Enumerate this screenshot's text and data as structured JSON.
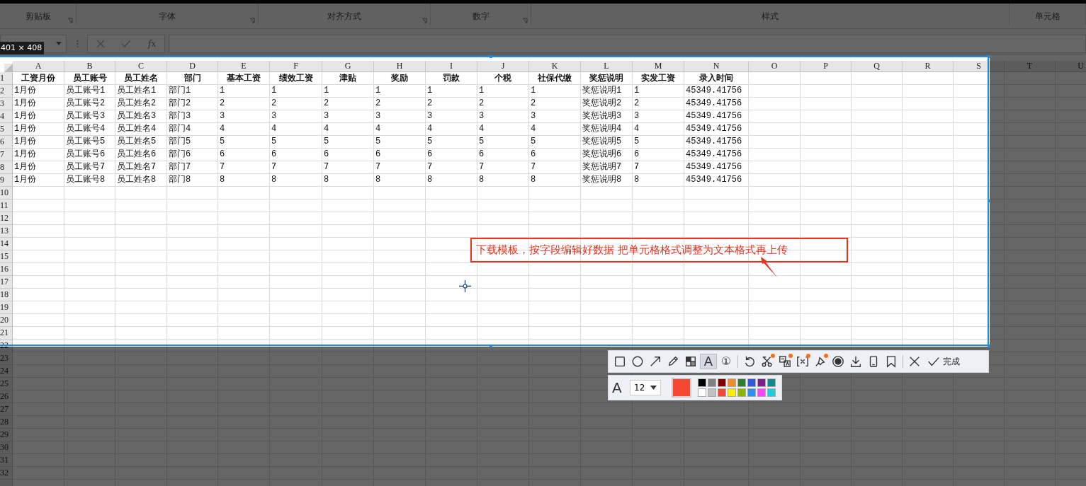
{
  "ribbon": {
    "groups": [
      {
        "label": "剪贴板",
        "launcher": true
      },
      {
        "label": "字体",
        "launcher": true
      },
      {
        "label": "对齐方式",
        "launcher": true
      },
      {
        "label": "数字",
        "launcher": true
      },
      {
        "label": "样式",
        "launcher": false
      },
      {
        "label": "单元格",
        "launcher": false
      }
    ]
  },
  "formula_bar": {
    "function_button": "fx"
  },
  "sheet": {
    "columns": [
      "A",
      "B",
      "C",
      "D",
      "E",
      "F",
      "G",
      "H",
      "I",
      "J",
      "K",
      "L",
      "M",
      "N",
      "O",
      "P",
      "Q",
      "R",
      "S",
      "T",
      "U"
    ],
    "rows": [
      {
        "number": "1",
        "kind": "header",
        "cells": [
          "工资月份",
          "员工账号",
          "员工姓名",
          "部门",
          "基本工资",
          "绩效工资",
          "津贴",
          "奖励",
          "罚款",
          "个税",
          "社保代缴",
          "奖惩说明",
          "实发工资",
          "录入时间"
        ]
      },
      {
        "number": "2",
        "kind": "data",
        "cells": [
          "1月份",
          "员工账号1",
          "员工姓名1",
          "部门1",
          "1",
          "1",
          "1",
          "1",
          "1",
          "1",
          "1",
          "奖惩说明1",
          "1",
          "45349.41756"
        ]
      },
      {
        "number": "3",
        "kind": "data",
        "cells": [
          "1月份",
          "员工账号2",
          "员工姓名2",
          "部门2",
          "2",
          "2",
          "2",
          "2",
          "2",
          "2",
          "2",
          "奖惩说明2",
          "2",
          "45349.41756"
        ]
      },
      {
        "number": "4",
        "kind": "data",
        "cells": [
          "1月份",
          "员工账号3",
          "员工姓名3",
          "部门3",
          "3",
          "3",
          "3",
          "3",
          "3",
          "3",
          "3",
          "奖惩说明3",
          "3",
          "45349.41756"
        ]
      },
      {
        "number": "5",
        "kind": "data",
        "cells": [
          "1月份",
          "员工账号4",
          "员工姓名4",
          "部门4",
          "4",
          "4",
          "4",
          "4",
          "4",
          "4",
          "4",
          "奖惩说明4",
          "4",
          "45349.41756"
        ]
      },
      {
        "number": "6",
        "kind": "data",
        "cells": [
          "1月份",
          "员工账号5",
          "员工姓名5",
          "部门5",
          "5",
          "5",
          "5",
          "5",
          "5",
          "5",
          "5",
          "奖惩说明5",
          "5",
          "45349.41756"
        ]
      },
      {
        "number": "7",
        "kind": "data",
        "cells": [
          "1月份",
          "员工账号6",
          "员工姓名6",
          "部门6",
          "6",
          "6",
          "6",
          "6",
          "6",
          "6",
          "6",
          "奖惩说明6",
          "6",
          "45349.41756"
        ]
      },
      {
        "number": "8",
        "kind": "data",
        "cells": [
          "1月份",
          "员工账号7",
          "员工姓名7",
          "部门7",
          "7",
          "7",
          "7",
          "7",
          "7",
          "7",
          "7",
          "奖惩说明7",
          "7",
          "45349.41756"
        ]
      },
      {
        "number": "9",
        "kind": "data",
        "cells": [
          "1月份",
          "员工账号8",
          "员工姓名8",
          "部门8",
          "8",
          "8",
          "8",
          "8",
          "8",
          "8",
          "8",
          "奖惩说明8",
          "8",
          "45349.41756"
        ]
      },
      {
        "number": "10"
      },
      {
        "number": "11"
      },
      {
        "number": "12"
      },
      {
        "number": "13"
      },
      {
        "number": "14"
      },
      {
        "number": "15"
      },
      {
        "number": "16"
      },
      {
        "number": "17"
      },
      {
        "number": "18"
      },
      {
        "number": "19"
      },
      {
        "number": "20"
      },
      {
        "number": "21"
      },
      {
        "number": "22"
      },
      {
        "number": "23"
      },
      {
        "number": "24"
      },
      {
        "number": "25"
      },
      {
        "number": "26"
      },
      {
        "number": "27"
      },
      {
        "number": "28"
      },
      {
        "number": "29"
      },
      {
        "number": "30"
      },
      {
        "number": "31"
      },
      {
        "number": "32"
      }
    ]
  },
  "capture": {
    "size_label": "401 × 408",
    "annotation": {
      "text": "下载模板，按字段编辑好数据 把单元格格式调整为文本格式再上传",
      "color": "#e8321e"
    },
    "tools": [
      {
        "kind": "rectangle",
        "selected": false,
        "badge": false
      },
      {
        "kind": "ellipse",
        "selected": false,
        "badge": false
      },
      {
        "kind": "arrow",
        "selected": false,
        "badge": false
      },
      {
        "kind": "pencil",
        "selected": false,
        "badge": false
      },
      {
        "kind": "mosaic",
        "selected": false,
        "badge": false
      },
      {
        "kind": "text",
        "glyph": "A",
        "selected": true,
        "badge": false
      },
      {
        "kind": "marker",
        "glyph": "①",
        "selected": false,
        "badge": false
      },
      {
        "kind": "separator"
      },
      {
        "kind": "undo",
        "selected": false,
        "badge": false
      },
      {
        "kind": "scissors",
        "selected": false,
        "badge": true
      },
      {
        "kind": "translate",
        "selected": false,
        "badge": true
      },
      {
        "kind": "brackets",
        "selected": false,
        "badge": true
      },
      {
        "kind": "pin",
        "selected": false,
        "badge": true
      },
      {
        "kind": "record",
        "selected": false,
        "badge": false
      },
      {
        "kind": "download",
        "selected": false,
        "badge": false
      },
      {
        "kind": "phone",
        "selected": false,
        "badge": false
      },
      {
        "kind": "bookmark",
        "selected": false,
        "badge": false
      },
      {
        "kind": "separator"
      },
      {
        "kind": "close",
        "selected": false,
        "badge": false
      },
      {
        "kind": "done",
        "label": "完成",
        "selected": false,
        "badge": false
      }
    ],
    "style": {
      "font_glyph": "A",
      "font_size": "12",
      "current": {
        "color": "#f4472f"
      },
      "palette": [
        {
          "color": "#000000"
        },
        {
          "color": "#808080"
        },
        {
          "color": "#800000"
        },
        {
          "color": "#f28a30"
        },
        {
          "color": "#2e7d32"
        },
        {
          "color": "#3358dd"
        },
        {
          "color": "#7b1f8a"
        },
        {
          "color": "#13878f"
        },
        {
          "color": "#ffffff"
        },
        {
          "color": "#c0c0c0"
        },
        {
          "color": "#f04a36"
        },
        {
          "color": "#ffee00"
        },
        {
          "color": "#8db600"
        },
        {
          "color": "#3090e8"
        },
        {
          "color": "#ff44ff"
        },
        {
          "color": "#22ccdd"
        }
      ]
    }
  }
}
